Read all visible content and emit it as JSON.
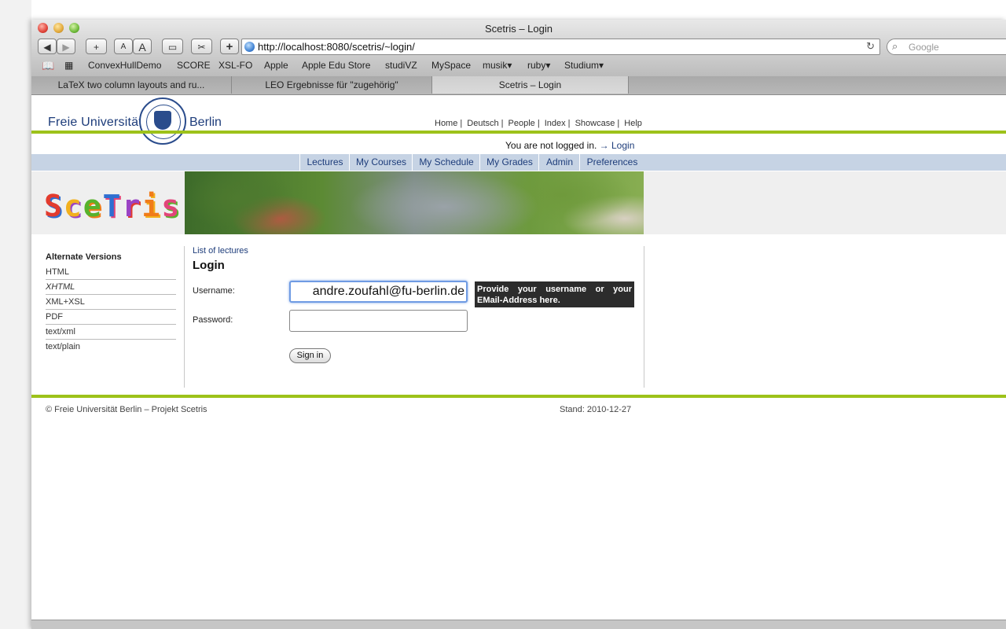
{
  "window": {
    "title": "Scetris – Login"
  },
  "toolbar": {
    "back": "◀",
    "forward": "▶",
    "add_bookmark": "+",
    "text_small": "A",
    "text_large": "A",
    "reader": "▭",
    "snip": "✂",
    "new_tab": "+",
    "url": "http://localhost:8080/scetris/~login/",
    "reload": "↻",
    "search_placeholder": "Google"
  },
  "bookmarks": [
    "ConvexHullDemo",
    "SCORE",
    "XSL-FO",
    "Apple",
    "Apple Edu Store",
    "studiVZ",
    "MySpace",
    "musik▾",
    "ruby▾",
    "Studium▾"
  ],
  "tabs": [
    {
      "label": "LaTeX two column layouts and ru..."
    },
    {
      "label": "LEO Ergebnisse für \"zugehörig\""
    },
    {
      "label": "Scetris – Login"
    }
  ],
  "header": {
    "uni_left": "Freie Universität",
    "uni_right": "Berlin",
    "nav": [
      "Home",
      "Deutsch",
      "People",
      "Index",
      "Showcase",
      "Help"
    ],
    "login_status": "You are not logged in.",
    "login_link": "→ Login"
  },
  "menu": [
    "Lectures",
    "My Courses",
    "My Schedule",
    "My Grades",
    "Admin",
    "Preferences"
  ],
  "logo": {
    "text": "SceTris",
    "colors": [
      "#e23b2e",
      "#f2b01e",
      "#58b22c",
      "#2f6fd1",
      "#9a43c4",
      "#f07c1a",
      "#e2457a"
    ]
  },
  "sidebar": {
    "title": "Alternate Versions",
    "items": [
      "HTML",
      "XHTML",
      "XML+XSL",
      "PDF",
      "text/xml",
      "text/plain"
    ]
  },
  "content": {
    "breadcrumb": "List of lectures",
    "heading": "Login",
    "username_label": "Username:",
    "username_value": "andre.zoufahl@fu-berlin.de",
    "password_label": "Password:",
    "tooltip": "Provide your username or your EMail-Address here.",
    "sign_in": "Sign in"
  },
  "footer": {
    "left": "© Freie Universität Berlin – Projekt Scetris",
    "right": "Stand:  2010-12-27"
  }
}
